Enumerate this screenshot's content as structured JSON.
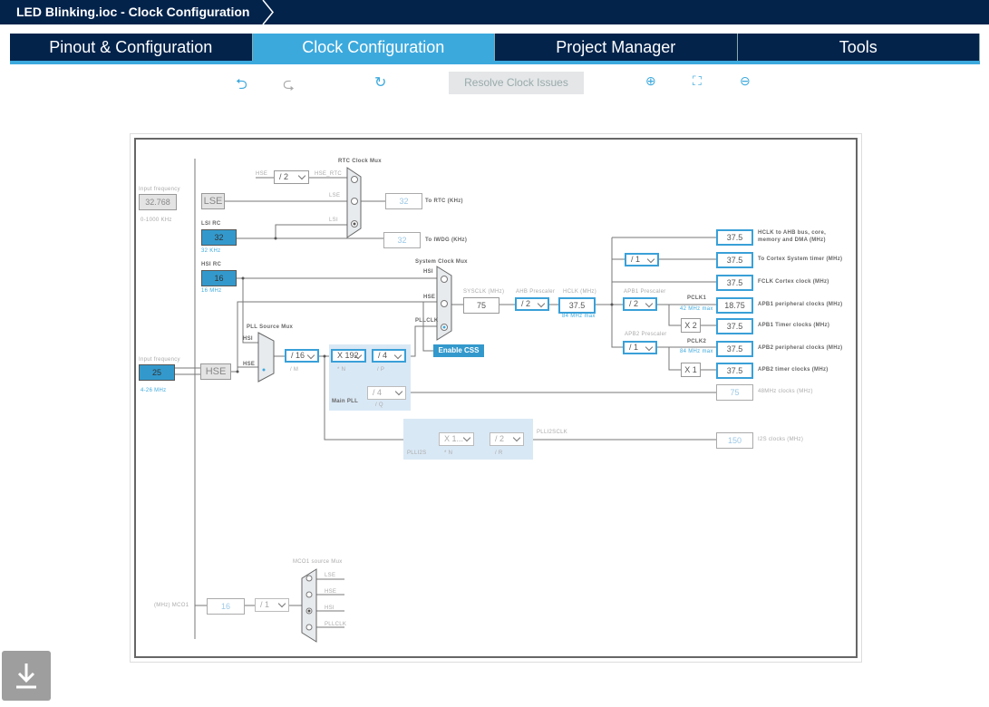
{
  "window": {
    "title": "LED Blinking.ioc - Clock Configuration"
  },
  "tabs": [
    {
      "label": "Pinout & Configuration"
    },
    {
      "label": "Clock Configuration",
      "active": true
    },
    {
      "label": "Project Manager"
    },
    {
      "label": "Tools"
    }
  ],
  "toolbar": {
    "undo": "undo-icon",
    "redo": "redo-icon",
    "reset": "refresh-icon",
    "resolve_label": "Resolve Clock Issues",
    "zoom_in": "zoom-in-icon",
    "fit": "fit-icon",
    "zoom_out": "zoom-out-icon"
  },
  "colors": {
    "navy": "#03234b",
    "accent": "#3ca9dd",
    "box_fill": "#3399cc"
  },
  "diagram": {
    "lse": {
      "input_label": "Input frequency",
      "input_value": "32.768",
      "range": "0-1000 KHz",
      "name": "LSE"
    },
    "lsi": {
      "label": "LSI RC",
      "value": "32",
      "unit": "32 KHz"
    },
    "hsi": {
      "label": "HSI RC",
      "value": "16",
      "unit": "16 MHz"
    },
    "hse": {
      "input_label": "Input frequency",
      "input_value": "25",
      "range": "4-26 MHz",
      "name": "HSE"
    },
    "rtc": {
      "mux_label": "RTC Clock Mux",
      "hse_in": "HSE",
      "div": "/ 2",
      "hse_rtc": "HSE_RTC",
      "lse_in": "LSE",
      "lsi_in": "LSI",
      "rtc_value": "32",
      "rtc_label": "To RTC (KHz)",
      "iwdg_value": "32",
      "iwdg_label": "To IWDG (KHz)"
    },
    "sysmux": {
      "label": "System Clock Mux",
      "hsi": "HSI",
      "hse": "HSE",
      "pllclk": "PLLCLK",
      "css": "Enable CSS"
    },
    "sysclk": {
      "label": "SYSCLK (MHz)",
      "value": "75"
    },
    "ahb": {
      "label": "AHB Prescaler",
      "value": "/ 2"
    },
    "hclk": {
      "label": "HCLK (MHz)",
      "value": "37.5",
      "max": "84 MHz max"
    },
    "pllsrc": {
      "label": "PLL Source Mux",
      "hsi": "HSI",
      "hse": "HSE"
    },
    "pll": {
      "m": "/ 16",
      "m_label": "/ M",
      "n": "X 192",
      "n_label": "* N",
      "p": "/ 4",
      "p_label": "/ P",
      "q": "/ 4",
      "q_label": "/ Q",
      "label": "Main PLL"
    },
    "plli2s": {
      "n": "X 1...",
      "n_label": "* N",
      "r": "/ 2",
      "r_label": "/ R",
      "label": "PLLI2S",
      "clk_label": "PLLI2SCLK"
    },
    "cortex_div": "/ 1",
    "apb1": {
      "label": "APB1 Prescaler",
      "value": "/ 2",
      "pclk": "PCLK1",
      "max": "42 MHz max",
      "timer_mul": "X 2"
    },
    "apb2": {
      "label": "APB2 Prescaler",
      "value": "/ 1",
      "pclk": "PCLK2",
      "max": "84 MHz max",
      "timer_mul": "X 1"
    },
    "outputs": [
      {
        "value": "37.5",
        "label": "HCLK to AHB bus, core,",
        "label2": "memory and DMA (MHz)"
      },
      {
        "value": "37.5",
        "label": "To Cortex System timer (MHz)"
      },
      {
        "value": "37.5",
        "label": "FCLK Cortex clock (MHz)"
      },
      {
        "value": "18.75",
        "label": "APB1 peripheral clocks (MHz)"
      },
      {
        "value": "37.5",
        "label": "APB1 Timer clocks (MHz)"
      },
      {
        "value": "37.5",
        "label": "APB2 peripheral clocks (MHz)"
      },
      {
        "value": "37.5",
        "label": "APB2 timer clocks (MHz)"
      }
    ],
    "usb": {
      "value": "75",
      "label": "48MHz clocks (MHz)"
    },
    "i2s": {
      "value": "150",
      "label": "I2S clocks (MHz)"
    },
    "mco": {
      "mux_label": "MCO1 source Mux",
      "lse": "LSE",
      "hse": "HSE",
      "hsi": "HSI",
      "pllclk": "PLLCLK",
      "div": "/ 1",
      "value": "16",
      "label": "(MHz) MCO1"
    }
  }
}
